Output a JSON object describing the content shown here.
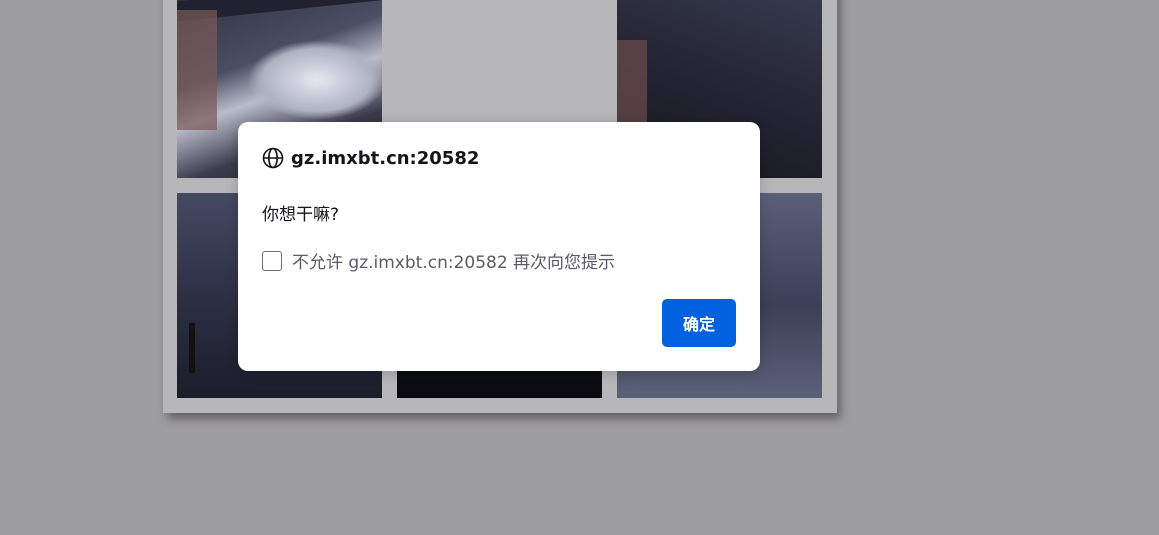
{
  "dialog": {
    "origin": "gz.imxbt.cn:20582",
    "message": "你想干嘛?",
    "checkbox_label": "不允许 gz.imxbt.cn:20582 再次向您提示",
    "checkbox_checked": false,
    "ok_label": "确定",
    "icon": "globe-icon"
  },
  "colors": {
    "backdrop": "#9d9c9e",
    "button": "#0061e0"
  }
}
